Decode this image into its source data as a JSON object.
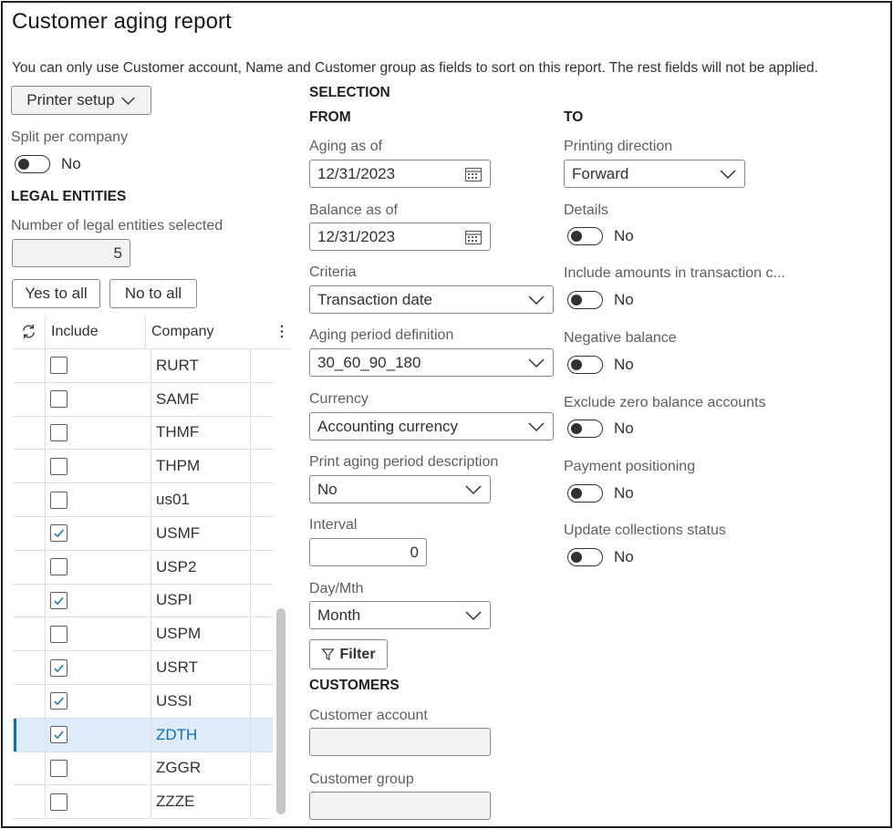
{
  "title": "Customer aging report",
  "notice": "You can only use Customer account, Name and Customer group as fields to sort on this report. The rest fields will not be applied.",
  "printer_setup": "Printer setup",
  "split_per_company": {
    "label": "Split per company",
    "value": "No"
  },
  "legal_entities": {
    "heading": "LEGAL ENTITIES",
    "count_label": "Number of legal entities selected",
    "count_value": "5",
    "yes_to_all": "Yes to all",
    "no_to_all": "No to all",
    "grid": {
      "col_include": "Include",
      "col_company": "Company",
      "rows": [
        {
          "company": "RURT",
          "checked": false
        },
        {
          "company": "SAMF",
          "checked": false
        },
        {
          "company": "THMF",
          "checked": false
        },
        {
          "company": "THPM",
          "checked": false
        },
        {
          "company": "us01",
          "checked": false
        },
        {
          "company": "USMF",
          "checked": true
        },
        {
          "company": "USP2",
          "checked": false
        },
        {
          "company": "USPI",
          "checked": true
        },
        {
          "company": "USPM",
          "checked": false
        },
        {
          "company": "USRT",
          "checked": true
        },
        {
          "company": "USSI",
          "checked": true
        },
        {
          "company": "ZDTH",
          "checked": true,
          "selected": true
        },
        {
          "company": "ZGGR",
          "checked": false
        },
        {
          "company": "ZZZE",
          "checked": false
        }
      ]
    }
  },
  "selection": {
    "heading": "SELECTION",
    "from_heading": "FROM",
    "to_heading": "TO",
    "aging_as_of": {
      "label": "Aging as of",
      "value": "12/31/2023"
    },
    "balance_as_of": {
      "label": "Balance as of",
      "value": "12/31/2023"
    },
    "criteria": {
      "label": "Criteria",
      "value": "Transaction date"
    },
    "aging_period_definition": {
      "label": "Aging period definition",
      "value": "30_60_90_180"
    },
    "currency": {
      "label": "Currency",
      "value": "Accounting currency"
    },
    "print_aging_period_description": {
      "label": "Print aging period description",
      "value": "No"
    },
    "interval": {
      "label": "Interval",
      "value": "0"
    },
    "day_mth": {
      "label": "Day/Mth",
      "value": "Month"
    },
    "filter_button": "Filter",
    "printing_direction": {
      "label": "Printing direction",
      "value": "Forward"
    },
    "details": {
      "label": "Details",
      "value": "No"
    },
    "include_amounts": {
      "label": "Include amounts in transaction c...",
      "value": "No"
    },
    "negative_balance": {
      "label": "Negative balance",
      "value": "No"
    },
    "exclude_zero": {
      "label": "Exclude zero balance accounts",
      "value": "No"
    },
    "payment_positioning": {
      "label": "Payment positioning",
      "value": "No"
    },
    "update_collections": {
      "label": "Update collections status",
      "value": "No"
    }
  },
  "customers": {
    "heading": "CUSTOMERS",
    "customer_account": {
      "label": "Customer account",
      "value": ""
    },
    "customer_group": {
      "label": "Customer group",
      "value": ""
    }
  },
  "colors": {
    "accent": "#0f6cbd",
    "selected_row": "#deecf9"
  }
}
